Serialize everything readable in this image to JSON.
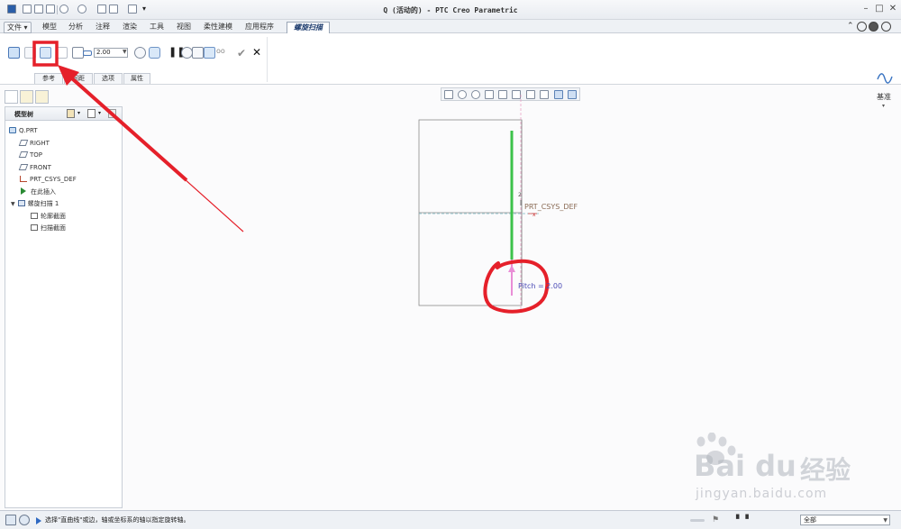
{
  "window": {
    "title": "Q (活动的) - PTC Creo Parametric"
  },
  "menu": {
    "tabs": [
      "文件",
      "模型",
      "分析",
      "注释",
      "渲染",
      "工具",
      "视图",
      "柔性建模",
      "应用程序"
    ],
    "active_tab": "螺旋扫描"
  },
  "ribbon": {
    "pitch_value": "2.00",
    "subtabs": [
      "参考",
      "间距",
      "选项",
      "属性"
    ],
    "datum_label": "基准"
  },
  "tree": {
    "header": "模型树",
    "items": [
      {
        "label": "Q.PRT",
        "icon": "part-icon",
        "level": 0
      },
      {
        "label": "RIGHT",
        "icon": "datum-plane-icon",
        "level": 1
      },
      {
        "label": "TOP",
        "icon": "datum-plane-icon",
        "level": 1
      },
      {
        "label": "FRONT",
        "icon": "datum-plane-icon",
        "level": 1
      },
      {
        "label": "PRT_CSYS_DEF",
        "icon": "csys-icon",
        "level": 1
      },
      {
        "label": "在此插入",
        "icon": "insert-here-icon",
        "level": 1
      },
      {
        "label": "螺旋扫描 1",
        "icon": "helical-sweep-icon",
        "level": 1
      },
      {
        "label": "轮廓截面",
        "icon": "sketch-icon",
        "level": 2
      },
      {
        "label": "扫描截面",
        "icon": "sketch-icon",
        "level": 2
      }
    ]
  },
  "graphics": {
    "csys_label": "PRT_CSYS_DEF",
    "pitch_label": "Pitch = 2.00",
    "axis_tag": "2"
  },
  "status": {
    "message": "选择\"直曲线\"或边，轴或坐标系的轴以指定旋转轴。",
    "filter": "全部"
  },
  "watermark": {
    "brand": "Bai du",
    "brand_cn": "经验",
    "url": "jingyan.baidu.com"
  },
  "colors": {
    "annotation_red": "#e5202a",
    "profile_green": "#3cc24a",
    "pitch_pink": "#e98ed6"
  }
}
